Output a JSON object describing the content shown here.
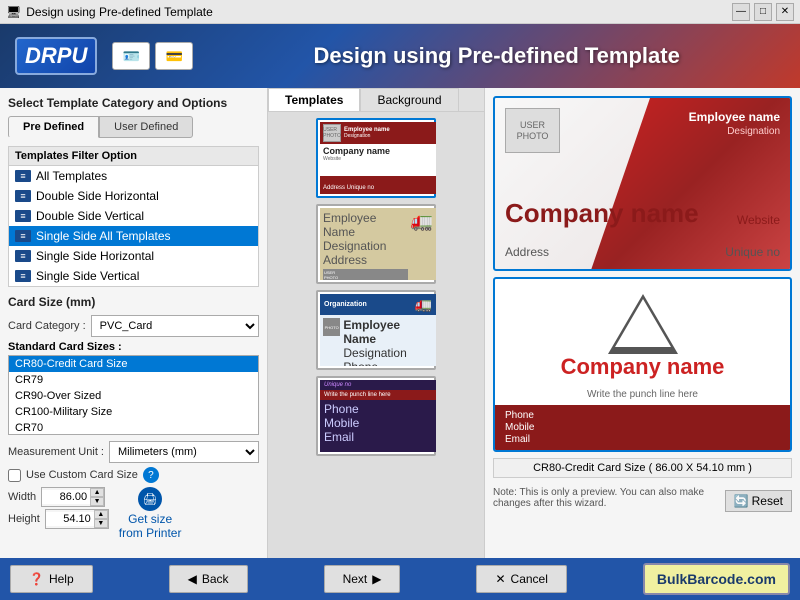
{
  "titleBar": {
    "title": "Design using Pre-defined Template",
    "icon": "🖥"
  },
  "header": {
    "logo": "DRPU",
    "title": "Design using Pre-defined Template"
  },
  "leftPanel": {
    "sectionTitle": "Select Template Category and Options",
    "tabs": {
      "tab1": "Pre Defined",
      "tab2": "User Defined"
    },
    "filterSection": {
      "header": "Templates Filter Option",
      "items": [
        "All Templates",
        "Double Side Horizontal",
        "Double Side Vertical",
        "Single Side All Templates",
        "Single Side Horizontal",
        "Single Side Vertical"
      ]
    },
    "cardSize": {
      "label": "Card Size (mm)",
      "categoryLabel": "Card Category :",
      "categoryValue": "PVC_Card",
      "standardSizesLabel": "Standard Card Sizes :",
      "sizes": [
        "CR80-Credit Card Size",
        "CR79",
        "CR90-Over Sized",
        "CR100-Military Size",
        "CR70"
      ],
      "selectedSize": "CR80-Credit Card Size",
      "measurementLabel": "Measurement Unit :",
      "measurementValue": "Milimeters (mm)",
      "customSizeLabel": "Use Custom Card Size",
      "helpTooltip": "?",
      "widthLabel": "Width",
      "widthValue": "86.00",
      "heightLabel": "Height",
      "heightValue": "54.10",
      "getSizeLabel": "Get size\nfrom Printer"
    }
  },
  "centerPanel": {
    "tabs": {
      "templates": "Templates",
      "background": "Background"
    }
  },
  "rightPanel": {
    "topCard": {
      "userPhoto": "USER\nPHOTO",
      "employeeName": "Employee name",
      "designation": "Designation",
      "companyName": "Company name",
      "website": "Website",
      "address": "Address",
      "uniqueNo": "Unique no"
    },
    "bottomCard": {
      "companyName": "Company name",
      "punchLine": "Write the punch line here",
      "phone": "Phone",
      "mobile": "Mobile",
      "email": "Email"
    },
    "sizeDisplay": "CR80-Credit Card Size ( 86.00 X 54.10 mm )",
    "note": "Note: This is only a preview. You can also make changes after this wizard.",
    "resetBtn": "Reset"
  },
  "bottomBar": {
    "helpBtn": "Help",
    "backBtn": "Back",
    "nextBtn": "Next",
    "cancelBtn": "Cancel",
    "bulkBarcode": "BulkBarcode.com"
  }
}
